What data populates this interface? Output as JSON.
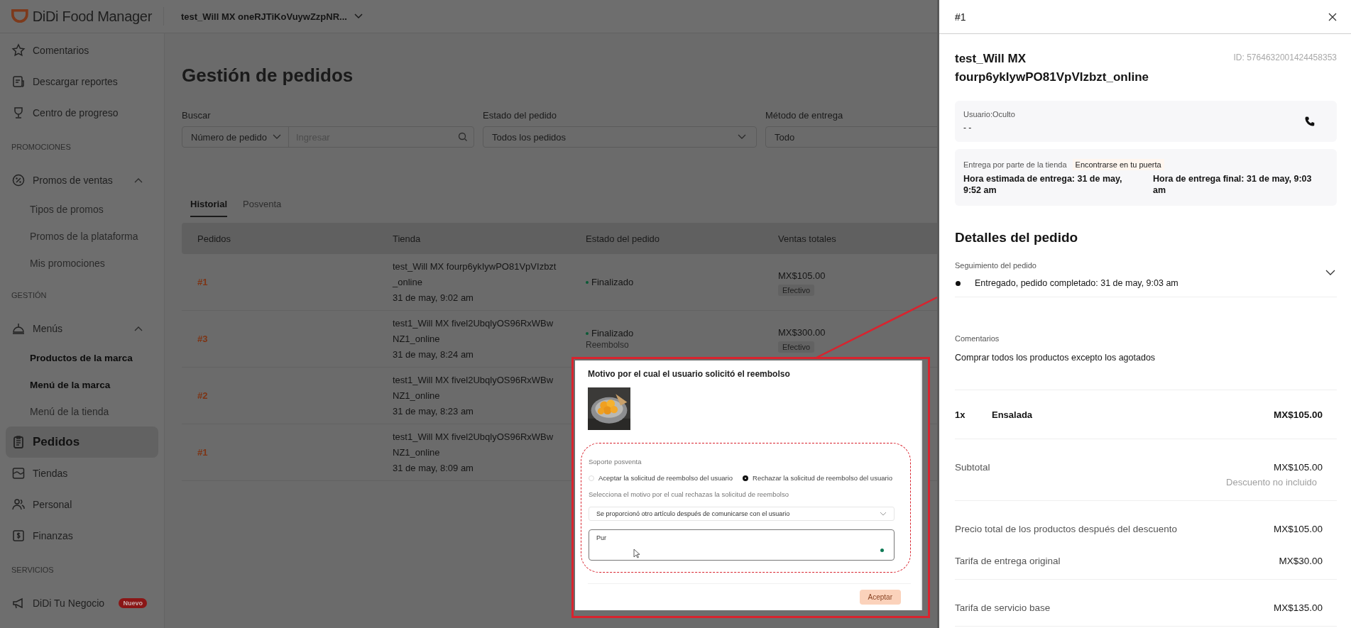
{
  "header": {
    "logo_text": "DiDi Food Manager",
    "store_selector": "test_Will MX oneRJTiKoVuywZzpNR..."
  },
  "sidebar": {
    "items": [
      {
        "kind": "item",
        "label": "Comentarios",
        "selected": false
      },
      {
        "kind": "item",
        "label": "Descargar reportes",
        "selected": false
      },
      {
        "kind": "item",
        "label": "Centro de progreso",
        "selected": false
      },
      {
        "kind": "section",
        "label": "PROMOCIONES"
      },
      {
        "kind": "group",
        "label": "Promos de ventas",
        "selected": false,
        "expanded": true,
        "children": [
          {
            "label": "Tipos de promos",
            "selected": false,
            "emphasized": false
          },
          {
            "label": "Promos de la plataforma",
            "selected": false,
            "emphasized": false
          },
          {
            "label": "Mis promociones",
            "selected": false,
            "emphasized": false
          }
        ]
      },
      {
        "kind": "section",
        "label": "GESTIÓN"
      },
      {
        "kind": "group",
        "label": "Menús",
        "selected": false,
        "expanded": true,
        "children": [
          {
            "label": "Productos de la marca",
            "selected": false,
            "emphasized": true
          },
          {
            "label": "Menú de la marca",
            "selected": false,
            "emphasized": true
          },
          {
            "label": "Menú de la tienda",
            "selected": false,
            "emphasized": false
          }
        ]
      },
      {
        "kind": "item",
        "label": "Pedidos",
        "selected": true
      },
      {
        "kind": "item",
        "label": "Tiendas",
        "selected": false
      },
      {
        "kind": "item",
        "label": "Personal",
        "selected": false
      },
      {
        "kind": "item",
        "label": "Finanzas",
        "selected": false
      },
      {
        "kind": "section",
        "label": "SERVICIOS"
      },
      {
        "kind": "item",
        "label": "DiDi Tu Negocio",
        "selected": false,
        "badge": "Nuevo"
      }
    ]
  },
  "page": {
    "title": "Gestión de pedidos",
    "filters": [
      {
        "kind": "search",
        "label": "Buscar",
        "select": "Número de pedido",
        "placeholder": "Ingresar"
      },
      {
        "kind": "select",
        "label": "Estado del pedido",
        "value": "Todos los pedidos"
      },
      {
        "kind": "select",
        "label": "Método de entrega",
        "value": "Todo"
      }
    ],
    "tabs": [
      {
        "label": "Historial",
        "selected": true
      },
      {
        "label": "Posventa",
        "selected": false
      }
    ],
    "table": {
      "columns": [
        "Pedidos",
        "Tienda",
        "Estado del pedido",
        "Ventas totales"
      ],
      "rows": [
        {
          "order": "#1",
          "store": [
            "test_Will MX fourp6ykIywPO81VpVIzbzt",
            "_online",
            "31 de may, 9:02 am"
          ],
          "status": "Finalizado",
          "total": "MX$105.00",
          "payment": "Efectivo"
        },
        {
          "order": "#3",
          "store": [
            "test1_Will MX fivel2UbqlyOS96RxWBw",
            "NZ1_online",
            "31 de may, 8:24 am"
          ],
          "status": "Finalizado",
          "status_note": "Reembolso",
          "total": "MX$300.00",
          "payment": "Efectivo"
        },
        {
          "order": "#2",
          "store": [
            "test1_Will MX fivel2UbqlyOS96RxWBw",
            "NZ1_online",
            "31 de may, 8:23 am"
          ]
        },
        {
          "order": "#1",
          "store": [
            "test1_Will MX fivel2UbqlyOS96RxWBw",
            "NZ1_online",
            "31 de may, 8:09 am"
          ]
        }
      ]
    }
  },
  "refund_callout": {
    "title": "Motivo por el cual el usuario solicitó el reembolso",
    "section_label": "Soporte posventa",
    "options": [
      {
        "label": "Aceptar la solicitud de reembolso del usuario",
        "selected": false
      },
      {
        "label": "Rechazar la solicitud de reembolso del usuario",
        "selected": true
      }
    ],
    "reason_label": "Selecciona el motivo por el cual rechazas la solicitud de reembolso",
    "reason_value": "Se proporcionó otro artículo después de comunicarse con el usuario",
    "note_value": "Pur",
    "button": {
      "label": "Aceptar",
      "disabled": true
    }
  },
  "drawer": {
    "title": "#1",
    "store_name": "test_Will MX fourp6ykIywPO81VpVIzbzt_online",
    "order_id": "ID: 5764632001424458353",
    "customer": {
      "label": "Usuario:Oculto",
      "value": "- -"
    },
    "delivery": {
      "label": "Entrega por parte de la tienda",
      "tag": "Encontrarse en tu puerta",
      "estimated": "Hora estimada de entrega: 31 de may, 9:52 am",
      "final": "Hora de entrega final: 31 de may, 9:03 am"
    },
    "details_title": "Detalles del pedido",
    "tracking": {
      "label": "Seguimiento del pedido",
      "expanded": false,
      "events": [
        "Entregado, pedido completado: 31 de may, 9:03 am"
      ]
    },
    "comments": {
      "label": "Comentarios",
      "text": "Comprar todos los productos excepto los agotados"
    },
    "items": [
      {
        "qty": "1x",
        "name": "Ensalada",
        "price": "MX$105.00"
      }
    ],
    "summary": [
      {
        "rows": [
          {
            "label": "Subtotal",
            "value": "MX$105.00",
            "note": "Descuento no incluido"
          }
        ]
      },
      {
        "rows": [
          {
            "label": "Precio total de los productos después del descuento",
            "value": "MX$105.00"
          },
          {
            "label": "Tarifa de entrega original",
            "value": "MX$30.00"
          }
        ]
      },
      {
        "rows": [
          {
            "label": "Tarifa de servicio base",
            "value": "MX$135.00"
          }
        ]
      }
    ]
  }
}
